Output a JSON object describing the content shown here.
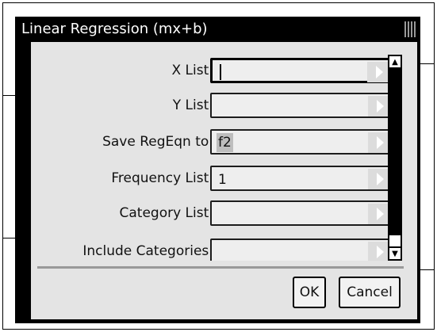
{
  "dialog": {
    "title": "Linear Regression (mx+b)"
  },
  "fields": [
    {
      "label": "X List:",
      "value": ""
    },
    {
      "label": "Y List:",
      "value": ""
    },
    {
      "label": "Save RegEqn to:",
      "value": "f2"
    },
    {
      "label": "Frequency List:",
      "value": "1"
    },
    {
      "label": "Category List:",
      "value": ""
    },
    {
      "label": "Include Categories:",
      "value": ""
    }
  ],
  "buttons": {
    "ok_label": "OK",
    "cancel_label": "Cancel"
  },
  "colors": {
    "titlebar": "#000000",
    "dialog_body": "#e4e4e4",
    "field_bg": "#eeeeee"
  }
}
